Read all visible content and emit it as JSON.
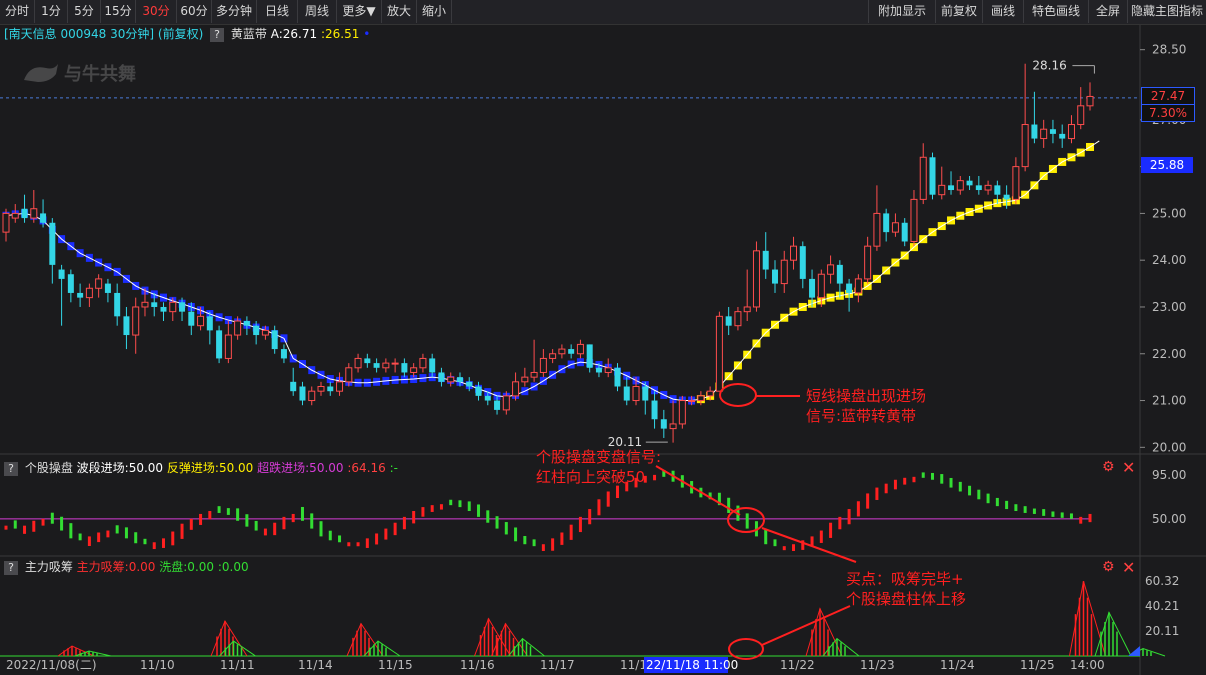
{
  "toolbar": {
    "periods": [
      "分时",
      "1分",
      "5分",
      "15分",
      "30分",
      "60分",
      "多分钟",
      "日线",
      "周线",
      "更多▼",
      "放大",
      "缩小"
    ],
    "active": "30分",
    "right": [
      "附加显示",
      "前复权",
      "画线",
      "特色画线",
      "全屏",
      "隐藏主图指标"
    ]
  },
  "title": {
    "stock": "[南天信息 000948 30分钟] (前复权)",
    "help": "?",
    "indicator": "黄蓝带",
    "a_label": "A:26.71",
    "b_label": ":26.51",
    "dot": "•",
    "logo": "与牛共舞"
  },
  "price_axis": [
    "28.50",
    "27.00",
    "26.00",
    "25.00",
    "24.00",
    "23.00",
    "22.00",
    "21.00",
    "20.00"
  ],
  "price_boxes": {
    "last": "27.47",
    "pct": "7.30%",
    "ref": "25.88"
  },
  "annotations": {
    "high": "28.16",
    "low": "20.11",
    "signal1_l1": "短线操盘出现进场",
    "signal1_l2": "信号:蓝带转黄带",
    "signal2_l1": "个股操盘变盘信号:",
    "signal2_l2": "红柱向上突破50",
    "signal3_l1": "买点：吸筹完毕+",
    "signal3_l2": "个股操盘柱体上移"
  },
  "sub1": {
    "name": "个股操盘",
    "wave": "波段进场:50.00",
    "rebound": "反弹进场:50.00",
    "oversold": "超跌进场:50.00",
    "val": ":64.16",
    "tail": ":-",
    "axis": [
      "95.00",
      "50.00"
    ]
  },
  "sub2": {
    "name": "主力吸筹",
    "absorb": "主力吸筹:0.00",
    "wash": "洗盘:0.00",
    "val": ":0.00",
    "axis": [
      "60.32",
      "40.21",
      "20.11"
    ]
  },
  "dates": [
    "2022/11/08(二)",
    "11/10",
    "11/11",
    "11/14",
    "11/15",
    "11/16",
    "11/17",
    "11/1",
    "22/11/18 11:00",
    "11/22",
    "11/23",
    "11/24",
    "11/25",
    "14:00"
  ],
  "colors": {
    "up": "#ff4d4d",
    "down": "#33d6e6",
    "yellow": "#ffee00",
    "blue": "#1a2cff",
    "magenta": "#d63cd6",
    "green": "#33dd33",
    "red": "#ff2020"
  },
  "chart_data": {
    "type": "candlestick",
    "ylim": [
      19.9,
      28.6
    ],
    "candles": [
      [
        24.6,
        25.0,
        25.1,
        24.4
      ],
      [
        24.9,
        25.0,
        25.2,
        24.8
      ],
      [
        25.1,
        24.9,
        25.4,
        24.8
      ],
      [
        24.9,
        25.1,
        25.5,
        24.8
      ],
      [
        25.0,
        24.8,
        25.3,
        24.7
      ],
      [
        24.8,
        23.9,
        24.9,
        23.5
      ],
      [
        23.8,
        23.6,
        23.9,
        22.6
      ],
      [
        23.7,
        23.3,
        23.8,
        23.1
      ],
      [
        23.3,
        23.2,
        23.5,
        23.0
      ],
      [
        23.2,
        23.4,
        23.5,
        23.0
      ],
      [
        23.4,
        23.6,
        23.7,
        23.2
      ],
      [
        23.5,
        23.3,
        23.6,
        23.1
      ],
      [
        23.3,
        22.8,
        23.5,
        22.6
      ],
      [
        22.8,
        22.4,
        23.0,
        22.1
      ],
      [
        22.4,
        23.0,
        23.2,
        22.0
      ],
      [
        23.0,
        23.1,
        23.4,
        22.8
      ],
      [
        23.1,
        23.0,
        23.3,
        22.8
      ],
      [
        23.0,
        22.9,
        23.1,
        22.7
      ],
      [
        22.9,
        23.1,
        23.2,
        22.7
      ],
      [
        23.1,
        22.9,
        23.2,
        22.7
      ],
      [
        22.9,
        22.6,
        23.1,
        22.4
      ],
      [
        22.6,
        22.8,
        23.0,
        22.5
      ],
      [
        22.8,
        22.5,
        22.9,
        22.2
      ],
      [
        22.5,
        21.9,
        22.6,
        21.8
      ],
      [
        21.9,
        22.4,
        22.7,
        21.8
      ],
      [
        22.4,
        22.7,
        22.8,
        22.3
      ],
      [
        22.7,
        22.6,
        22.8,
        22.4
      ],
      [
        22.6,
        22.4,
        22.7,
        22.2
      ],
      [
        22.4,
        22.5,
        22.6,
        22.3
      ],
      [
        22.5,
        22.1,
        22.6,
        22.0
      ],
      [
        22.1,
        21.9,
        22.2,
        21.8
      ],
      [
        21.4,
        21.2,
        21.7,
        21.1
      ],
      [
        21.3,
        21.0,
        21.4,
        20.9
      ],
      [
        21.0,
        21.2,
        21.3,
        20.9
      ],
      [
        21.2,
        21.3,
        21.4,
        21.1
      ],
      [
        21.3,
        21.2,
        21.4,
        21.1
      ],
      [
        21.2,
        21.4,
        21.6,
        21.1
      ],
      [
        21.4,
        21.7,
        21.8,
        21.3
      ],
      [
        21.7,
        21.9,
        22.0,
        21.6
      ],
      [
        21.9,
        21.8,
        22.0,
        21.7
      ],
      [
        21.8,
        21.7,
        21.9,
        21.6
      ],
      [
        21.7,
        21.8,
        21.9,
        21.6
      ],
      [
        21.8,
        21.8,
        21.9,
        21.6
      ],
      [
        21.8,
        21.6,
        21.9,
        21.5
      ],
      [
        21.6,
        21.7,
        21.8,
        21.5
      ],
      [
        21.7,
        21.9,
        22.0,
        21.6
      ],
      [
        21.9,
        21.6,
        22.0,
        21.5
      ],
      [
        21.6,
        21.4,
        21.7,
        21.3
      ],
      [
        21.4,
        21.5,
        21.6,
        21.3
      ],
      [
        21.5,
        21.4,
        21.6,
        21.3
      ],
      [
        21.4,
        21.3,
        21.5,
        21.2
      ],
      [
        21.3,
        21.1,
        21.4,
        21.0
      ],
      [
        21.1,
        21.0,
        21.2,
        20.9
      ],
      [
        21.0,
        20.8,
        21.1,
        20.7
      ],
      [
        20.8,
        21.1,
        21.2,
        20.7
      ],
      [
        21.1,
        21.4,
        21.6,
        21.0
      ],
      [
        21.4,
        21.5,
        21.7,
        21.3
      ],
      [
        21.5,
        21.6,
        22.3,
        21.4
      ],
      [
        21.6,
        21.9,
        22.1,
        21.5
      ],
      [
        21.9,
        22.0,
        22.1,
        21.8
      ],
      [
        22.0,
        22.1,
        22.2,
        21.9
      ],
      [
        22.1,
        22.0,
        22.2,
        21.9
      ],
      [
        22.0,
        22.2,
        22.3,
        21.9
      ],
      [
        22.2,
        21.7,
        22.2,
        21.6
      ],
      [
        21.7,
        21.6,
        21.8,
        21.5
      ],
      [
        21.6,
        21.7,
        21.9,
        21.5
      ],
      [
        21.7,
        21.3,
        21.8,
        21.2
      ],
      [
        21.3,
        21.0,
        21.5,
        20.9
      ],
      [
        21.0,
        21.3,
        21.5,
        20.9
      ],
      [
        21.3,
        21.0,
        21.4,
        20.7
      ],
      [
        21.0,
        20.6,
        21.2,
        20.4
      ],
      [
        20.6,
        20.4,
        20.8,
        20.2
      ],
      [
        20.4,
        20.5,
        21.0,
        20.1
      ],
      [
        20.5,
        21.0,
        21.1,
        20.4
      ],
      [
        21.0,
        21.0,
        21.1,
        20.9
      ],
      [
        21.0,
        21.1,
        21.2,
        20.9
      ],
      [
        21.1,
        21.2,
        21.3,
        21.0
      ],
      [
        21.2,
        22.8,
        22.9,
        21.2
      ],
      [
        22.8,
        22.6,
        23.0,
        22.4
      ],
      [
        22.6,
        22.9,
        23.0,
        22.5
      ],
      [
        22.9,
        23.0,
        23.8,
        22.7
      ],
      [
        23.0,
        24.2,
        24.4,
        22.9
      ],
      [
        24.2,
        23.8,
        24.6,
        23.6
      ],
      [
        23.8,
        23.5,
        24.0,
        23.3
      ],
      [
        23.5,
        24.0,
        24.2,
        23.3
      ],
      [
        24.0,
        24.3,
        24.5,
        23.8
      ],
      [
        24.3,
        23.6,
        24.4,
        23.4
      ],
      [
        23.6,
        23.2,
        23.8,
        23.0
      ],
      [
        23.2,
        23.7,
        23.8,
        23.0
      ],
      [
        23.7,
        23.9,
        24.1,
        23.5
      ],
      [
        23.9,
        23.5,
        24.0,
        23.2
      ],
      [
        23.5,
        23.3,
        23.6,
        22.9
      ],
      [
        23.3,
        23.6,
        23.7,
        23.1
      ],
      [
        23.6,
        24.3,
        24.5,
        23.5
      ],
      [
        24.3,
        25.0,
        25.6,
        24.2
      ],
      [
        25.0,
        24.6,
        25.1,
        24.4
      ],
      [
        24.6,
        24.8,
        25.0,
        24.5
      ],
      [
        24.8,
        24.4,
        24.9,
        24.3
      ],
      [
        24.4,
        25.3,
        25.5,
        24.3
      ],
      [
        25.3,
        26.2,
        26.5,
        25.2
      ],
      [
        26.2,
        25.4,
        26.3,
        25.3
      ],
      [
        25.4,
        25.6,
        26.0,
        25.3
      ],
      [
        25.6,
        25.5,
        25.9,
        25.4
      ],
      [
        25.5,
        25.7,
        25.8,
        25.4
      ],
      [
        25.7,
        25.6,
        25.8,
        25.5
      ],
      [
        25.6,
        25.5,
        25.8,
        25.4
      ],
      [
        25.5,
        25.6,
        25.7,
        25.4
      ],
      [
        25.6,
        25.4,
        25.7,
        25.2
      ],
      [
        25.4,
        25.3,
        25.6,
        25.1
      ],
      [
        25.3,
        26.0,
        26.2,
        25.2
      ],
      [
        26.0,
        26.9,
        28.2,
        25.9
      ],
      [
        26.9,
        26.6,
        27.6,
        26.5
      ],
      [
        26.6,
        26.8,
        27.0,
        26.4
      ],
      [
        26.8,
        26.7,
        27.0,
        26.5
      ],
      [
        26.7,
        26.6,
        26.9,
        26.4
      ],
      [
        26.6,
        26.9,
        27.1,
        26.5
      ],
      [
        26.9,
        27.3,
        27.7,
        26.8
      ],
      [
        27.3,
        27.5,
        27.8,
        27.2
      ]
    ],
    "band": [
      24.95,
      24.98,
      25.0,
      24.95,
      24.85,
      24.65,
      24.45,
      24.3,
      24.15,
      24.05,
      23.95,
      23.85,
      23.75,
      23.6,
      23.45,
      23.35,
      23.27,
      23.2,
      23.13,
      23.07,
      23.0,
      22.93,
      22.85,
      22.78,
      22.72,
      22.67,
      22.62,
      22.56,
      22.5,
      22.42,
      22.33,
      21.9,
      21.78,
      21.65,
      21.55,
      21.46,
      21.42,
      21.4,
      21.38,
      21.38,
      21.4,
      21.42,
      21.44,
      21.45,
      21.46,
      21.48,
      21.5,
      21.48,
      21.44,
      21.4,
      21.33,
      21.25,
      21.18,
      21.1,
      21.08,
      21.12,
      21.2,
      21.3,
      21.42,
      21.55,
      21.67,
      21.77,
      21.82,
      21.8,
      21.76,
      21.7,
      21.62,
      21.53,
      21.43,
      21.33,
      21.22,
      21.12,
      21.03,
      21.0,
      21.0,
      21.03,
      21.1,
      21.3,
      21.52,
      21.75,
      21.98,
      22.22,
      22.45,
      22.62,
      22.77,
      22.9,
      23.0,
      23.07,
      23.14,
      23.2,
      23.24,
      23.28,
      23.33,
      23.45,
      23.6,
      23.78,
      23.95,
      24.1,
      24.28,
      24.45,
      24.6,
      24.73,
      24.85,
      24.95,
      25.03,
      25.1,
      25.17,
      25.22,
      25.25,
      25.28,
      25.4,
      25.6,
      25.8,
      25.95,
      26.1,
      26.2,
      26.3,
      26.42,
      26.55
    ],
    "band_blue_until": 75,
    "osc": [
      43,
      40,
      43,
      48,
      50,
      45,
      38,
      30,
      28,
      32,
      36,
      38,
      35,
      30,
      25,
      24,
      26,
      30,
      37,
      45,
      50,
      55,
      58,
      56,
      54,
      48,
      42,
      38,
      40,
      46,
      52,
      55,
      48,
      40,
      32,
      28,
      26,
      26,
      26,
      30,
      35,
      40,
      46,
      52,
      58,
      62,
      64,
      65,
      64,
      62,
      58,
      52,
      46,
      40,
      34,
      27,
      24,
      22,
      24,
      30,
      36,
      44,
      52,
      60,
      70,
      78,
      84,
      88,
      92,
      94,
      95,
      93,
      88,
      82,
      76,
      72,
      70,
      64,
      56,
      48,
      40,
      32,
      24,
      22,
      22,
      24,
      28,
      32,
      38,
      46,
      52,
      60,
      68,
      76,
      82,
      86,
      90,
      92,
      93,
      92,
      90,
      86,
      82,
      78,
      74,
      70,
      66,
      63,
      60,
      58,
      56,
      55,
      53,
      52,
      51,
      50,
      52,
      55,
      58,
      62
    ],
    "osc_ylim": [
      15,
      100
    ],
    "absorb": [
      0,
      0,
      0,
      0,
      0,
      0,
      0,
      0,
      0,
      0,
      0,
      0,
      0,
      0,
      0,
      0,
      0,
      0,
      0,
      0,
      0,
      0,
      0,
      0,
      0,
      0,
      0,
      0,
      0,
      0,
      0,
      0,
      0,
      0,
      0,
      0,
      0,
      0,
      0,
      0,
      0,
      0,
      0,
      0,
      0,
      0,
      0,
      0,
      0,
      0,
      0,
      0,
      0,
      0,
      0,
      0,
      0,
      0,
      0,
      0,
      0,
      0,
      0,
      0,
      0,
      0,
      0,
      0,
      0,
      0,
      0,
      0,
      0,
      0,
      0,
      0,
      0,
      0,
      0,
      0,
      0,
      0,
      0,
      0,
      0,
      0,
      0,
      0,
      0,
      0,
      0,
      0,
      0,
      0,
      0,
      0,
      0,
      0,
      0,
      0,
      0,
      0,
      0,
      0,
      0,
      0,
      0,
      0,
      0,
      0,
      0,
      0,
      0,
      0,
      0,
      0,
      0,
      0,
      0,
      0
    ],
    "absorb_ylim": [
      0,
      65
    ]
  }
}
